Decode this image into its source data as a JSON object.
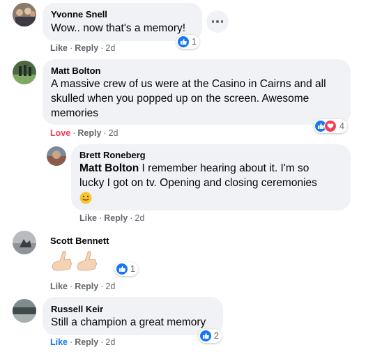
{
  "comments": [
    {
      "author": "Yvonne Snell",
      "text": "Wow.. now that's a memory!",
      "actions": {
        "like": "Like",
        "reply": "Reply",
        "time": "2d"
      },
      "reaction_count": "1"
    },
    {
      "author": "Matt Bolton",
      "text_lines": [
        "A massive crew of us were at the Casino in Cairns and all",
        "skulled when you popped up on the screen. Awesome",
        "memories"
      ],
      "actions": {
        "like": "Love",
        "reply": "Reply",
        "time": "2d"
      },
      "reaction_count": "4"
    },
    {
      "author": "Brett Roneberg",
      "mention": "Matt Bolton",
      "text_line1": " I remember hearing about it. I'm so",
      "text_line2": "lucky I got on tv. Opening and closing ceremonies",
      "actions": {
        "like": "Like",
        "reply": "Reply",
        "time": "2d"
      }
    },
    {
      "author": "Scott Bennett",
      "actions": {
        "like": "Like",
        "reply": "Reply",
        "time": "2d"
      },
      "reaction_count": "1"
    },
    {
      "author": "Russell Keir",
      "text": "Still a champion a great memory",
      "actions": {
        "like": "Like",
        "reply": "Reply",
        "time": "2d"
      },
      "reaction_count": "2"
    }
  ],
  "colors": {
    "like_blue": "#1877f2",
    "love_red": "#f33e58",
    "bubble": "#f0f2f5",
    "meta": "#65676b"
  },
  "icons": [
    "like-icon",
    "love-icon",
    "more-options-icon",
    "smile-emoji",
    "call-me-hand-emoji"
  ]
}
